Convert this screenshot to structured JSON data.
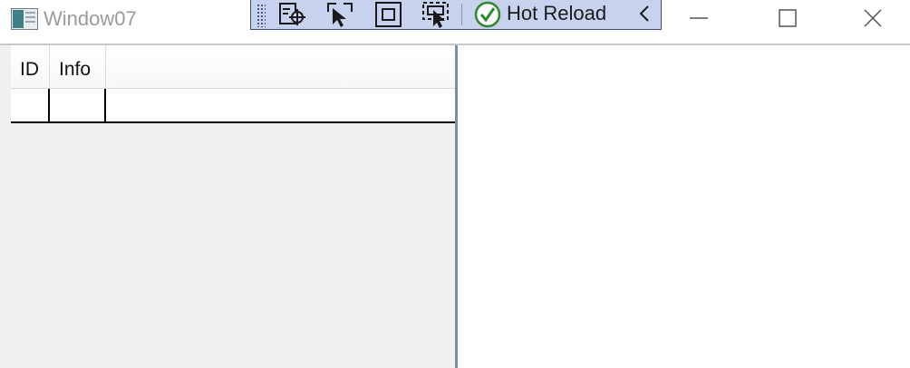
{
  "window": {
    "title": "Window07",
    "app_icon": "app-window-icon"
  },
  "hot_reload_toolbar": {
    "buttons": [
      {
        "icon": "select-element-icon"
      },
      {
        "icon": "pointer-select-icon"
      },
      {
        "icon": "layout-adorner-icon"
      },
      {
        "icon": "track-focus-icon"
      }
    ],
    "status_icon": "check-circle-icon",
    "label": "Hot Reload",
    "collapse_icon": "chevron-left-icon",
    "colors": {
      "background": "#c7d2ee",
      "border": "#3e4c7a",
      "status_green": "#2f8a2f"
    }
  },
  "caption_buttons": {
    "minimize_icon": "minimize-icon",
    "maximize_icon": "maximize-icon",
    "close_icon": "close-icon"
  },
  "grid": {
    "columns": [
      {
        "label": "ID"
      },
      {
        "label": "Info"
      }
    ],
    "rows": [
      {
        "cells": [
          "",
          "",
          ""
        ]
      }
    ]
  }
}
